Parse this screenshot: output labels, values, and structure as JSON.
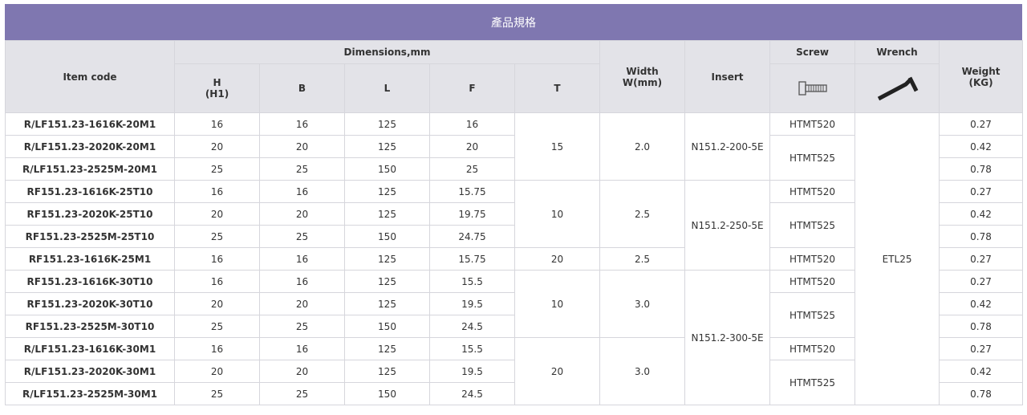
{
  "title": "產品規格",
  "header": {
    "item_code": "Item code",
    "dimensions": "Dimensions,mm",
    "h": "H",
    "h_sub": "(H1)",
    "b": "B",
    "l": "L",
    "f": "F",
    "t": "T",
    "width": "Width",
    "width_sub": "W(mm)",
    "insert": "Insert",
    "screw": "Screw",
    "wrench": "Wrench",
    "weight": "Weight",
    "weight_sub": "(KG)",
    "screw_icon": "screw-icon",
    "wrench_icon": "hex-wrench-icon"
  },
  "rows": [
    {
      "code": "R/LF151.23-1616K-20M1",
      "h": "16",
      "b": "16",
      "l": "125",
      "f": "16",
      "weight": "0.27"
    },
    {
      "code": "R/LF151.23-2020K-20M1",
      "h": "20",
      "b": "20",
      "l": "125",
      "f": "20",
      "weight": "0.42"
    },
    {
      "code": "R/LF151.23-2525M-20M1",
      "h": "25",
      "b": "25",
      "l": "150",
      "f": "25",
      "weight": "0.78"
    },
    {
      "code": "RF151.23-1616K-25T10",
      "h": "16",
      "b": "16",
      "l": "125",
      "f": "15.75",
      "weight": "0.27"
    },
    {
      "code": "RF151.23-2020K-25T10",
      "h": "20",
      "b": "20",
      "l": "125",
      "f": "19.75",
      "weight": "0.42"
    },
    {
      "code": "RF151.23-2525M-25T10",
      "h": "25",
      "b": "25",
      "l": "150",
      "f": "24.75",
      "weight": "0.78"
    },
    {
      "code": "RF151.23-1616K-25M1",
      "h": "16",
      "b": "16",
      "l": "125",
      "f": "15.75",
      "weight": "0.27"
    },
    {
      "code": "RF151.23-1616K-30T10",
      "h": "16",
      "b": "16",
      "l": "125",
      "f": "15.5",
      "weight": "0.27"
    },
    {
      "code": "RF151.23-2020K-30T10",
      "h": "20",
      "b": "20",
      "l": "125",
      "f": "19.5",
      "weight": "0.42"
    },
    {
      "code": "RF151.23-2525M-30T10",
      "h": "25",
      "b": "25",
      "l": "150",
      "f": "24.5",
      "weight": "0.78"
    },
    {
      "code": "R/LF151.23-1616K-30M1",
      "h": "16",
      "b": "16",
      "l": "125",
      "f": "15.5",
      "weight": "0.27"
    },
    {
      "code": "R/LF151.23-2020K-30M1",
      "h": "20",
      "b": "20",
      "l": "125",
      "f": "19.5",
      "weight": "0.42"
    },
    {
      "code": "R/LF151.23-2525M-30M1",
      "h": "25",
      "b": "25",
      "l": "150",
      "f": "24.5",
      "weight": "0.78"
    }
  ],
  "t_groups": [
    "15",
    "10",
    "20",
    "10",
    "20"
  ],
  "width_groups": [
    "2.0",
    "2.5",
    "2.5",
    "3.0",
    "3.0"
  ],
  "insert_groups": [
    "N151.2-200-5E",
    "N151.2-250-5E",
    "N151.2-300-5E"
  ],
  "screws": [
    "HTMT520",
    "HTMT525",
    "HTMT520",
    "HTMT525",
    "HTMT520",
    "HTMT520",
    "HTMT525",
    "HTMT520",
    "HTMT525"
  ],
  "wrench_value": "ETL25",
  "colors": {
    "title_bar": "#7f77b0",
    "header_bg": "#e3e3e8",
    "border": "#d6d6dc"
  }
}
